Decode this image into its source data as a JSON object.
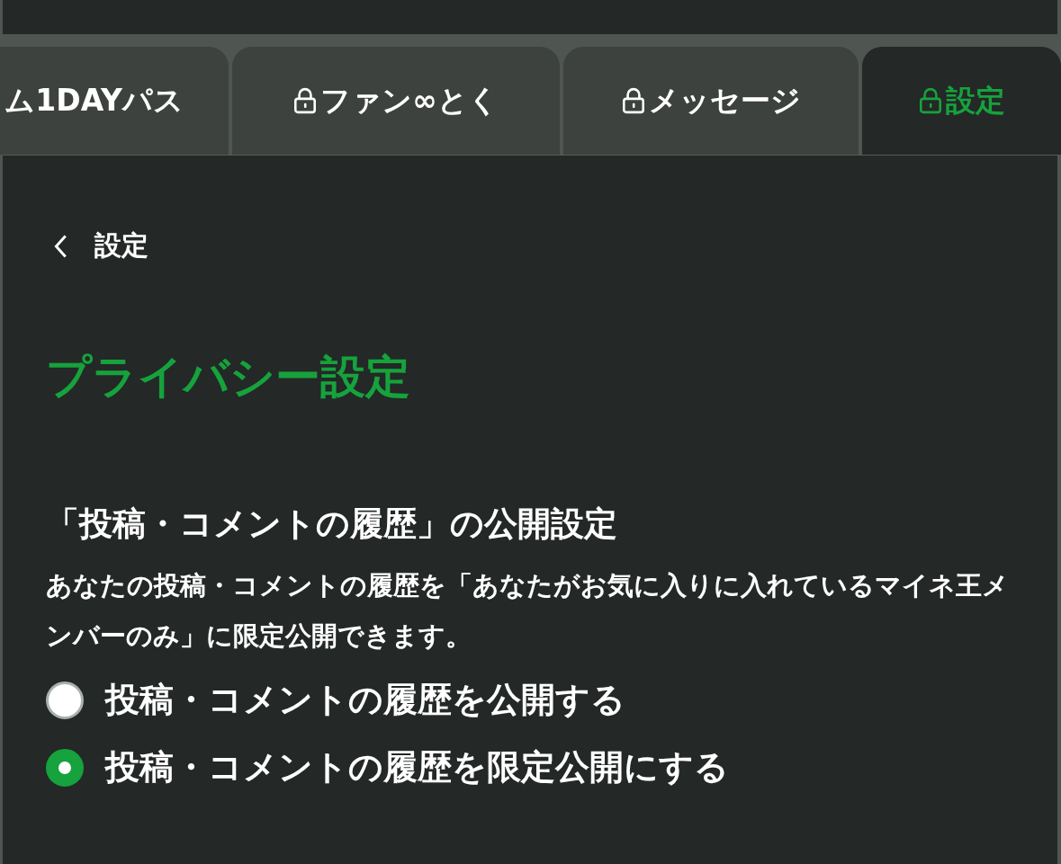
{
  "tabs": [
    {
      "label": "ム1DAYパス",
      "locked": false,
      "selected": false
    },
    {
      "label": "ファン∞とく",
      "locked": true,
      "selected": false
    },
    {
      "label": "メッセージ",
      "locked": true,
      "selected": false
    },
    {
      "label": "設定",
      "locked": true,
      "selected": true
    }
  ],
  "back": {
    "label": "設定"
  },
  "title": "プライバシー設定",
  "section": {
    "heading": "「投稿・コメントの履歴」の公開設定",
    "description": "あなたの投稿・コメントの履歴を「あなたがお気に入りに入れているマイネ王メンバーのみ」に限定公開できます。",
    "options": [
      {
        "label": "投稿・コメントの履歴を公開する",
        "selected": false
      },
      {
        "label": "投稿・コメントの履歴を限定公開にする",
        "selected": true
      }
    ]
  }
}
